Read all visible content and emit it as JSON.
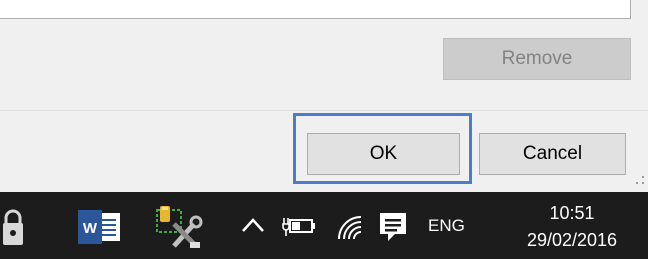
{
  "dialog": {
    "remove_label": "Remove",
    "ok_label": "OK",
    "cancel_label": "Cancel"
  },
  "taskbar": {
    "icons": [
      "lock-icon",
      "word-icon",
      "tools-icon",
      "chevron-up-icon",
      "battery-icon",
      "wifi-icon",
      "notification-icon"
    ],
    "language": "ENG",
    "time": "10:51",
    "date": "29/02/2016"
  },
  "colors": {
    "highlight": "#4a7fc8",
    "taskbar": "#1c1c1c",
    "word_blue": "#2b579a"
  }
}
